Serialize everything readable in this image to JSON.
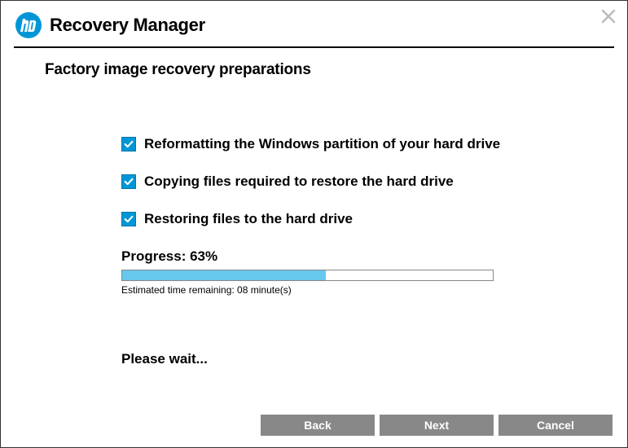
{
  "header": {
    "title": "Recovery Manager"
  },
  "subtitle": "Factory image recovery preparations",
  "steps": [
    {
      "label": "Reformatting the Windows partition of your hard drive",
      "checked": true
    },
    {
      "label": "Copying files required to restore the hard drive",
      "checked": true
    },
    {
      "label": "Restoring files to the hard drive",
      "checked": true
    }
  ],
  "progress": {
    "label": "Progress: 63%",
    "percent": 55,
    "time_remaining": "Estimated time remaining: 08 minute(s)"
  },
  "wait_text": "Please wait...",
  "buttons": {
    "back": "Back",
    "next": "Next",
    "cancel": "Cancel"
  },
  "colors": {
    "accent": "#0096d6",
    "progress_fill": "#66c8ed",
    "button_bg": "#888888"
  }
}
